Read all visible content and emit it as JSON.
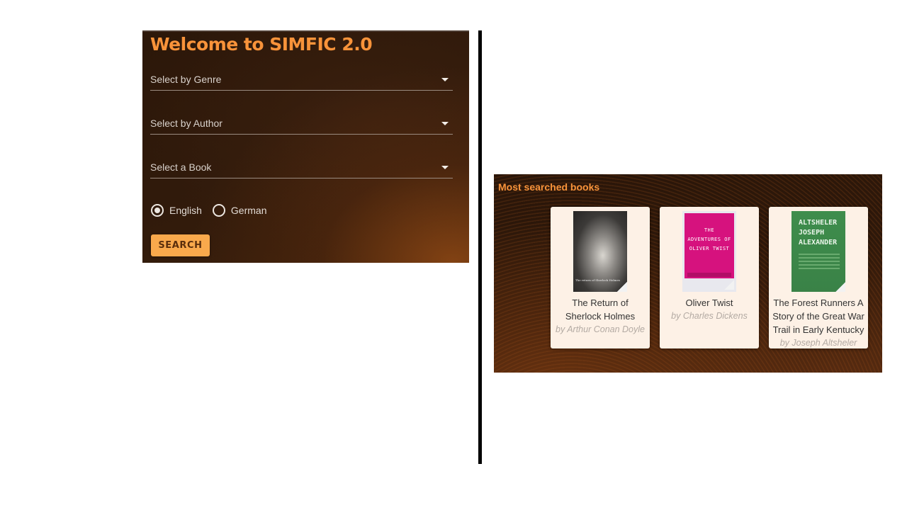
{
  "search_panel": {
    "title": "Welcome to SIMFIC 2.0",
    "genre_select": {
      "label": "Select by Genre",
      "icon": "caret-down-icon"
    },
    "author_select": {
      "label": "Select by Author",
      "icon": "caret-down-icon"
    },
    "book_select": {
      "label": "Select a Book",
      "icon": "caret-down-icon"
    },
    "languages": [
      {
        "label": "English",
        "selected": true
      },
      {
        "label": "German",
        "selected": false
      }
    ],
    "search_button_label": "SEARCH"
  },
  "most_searched": {
    "title": "Most searched books",
    "books": [
      {
        "title": "The Return of Sherlock Holmes",
        "author": "by Arthur Conan Doyle",
        "cover_caption": "The return of Sherlock Holmes"
      },
      {
        "title": "Oliver Twist",
        "author": "by Charles Dickens",
        "cover_text": "THE ADVENTURES OF OLIVER TWIST"
      },
      {
        "title": "The Forest Runners A Story of the Great War Trail in Early Kentucky",
        "author": "by Joseph Altsheler",
        "cover_text": "ALTSHELER JOSEPH ALEXANDER"
      }
    ]
  },
  "colors": {
    "accent": "#f8933a",
    "button_bg": "#f9a94c",
    "panel_bg": "#2e180a",
    "card_bg": "#fdf1e6"
  }
}
